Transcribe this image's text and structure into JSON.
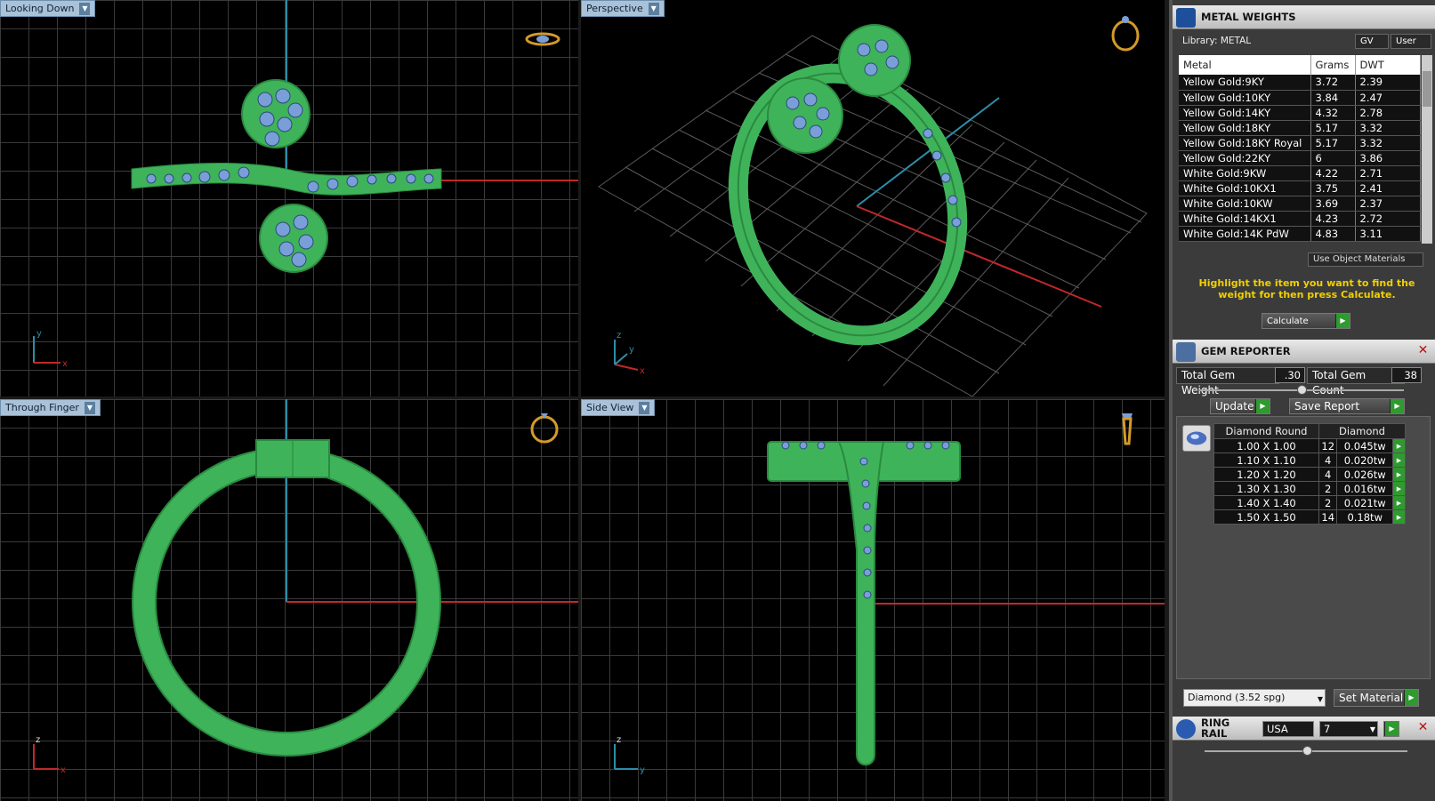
{
  "viewports": {
    "top_left": {
      "label": "Looking Down"
    },
    "top_right": {
      "label": "Perspective"
    },
    "bottom_left": {
      "label": "Through Finger"
    },
    "bottom_right": {
      "label": "Side View"
    }
  },
  "axes": {
    "x": "x",
    "y": "y",
    "z": "z"
  },
  "metal_weights": {
    "title": "METAL WEIGHTS",
    "library": "Library: METAL",
    "gv_label": "GV",
    "user_label": "User",
    "columns": [
      "Metal",
      "Grams",
      "DWT"
    ],
    "rows": [
      {
        "metal": "Yellow Gold:9KY",
        "grams": "3.72",
        "dwt": "2.39"
      },
      {
        "metal": "Yellow Gold:10KY",
        "grams": "3.84",
        "dwt": "2.47"
      },
      {
        "metal": "Yellow Gold:14KY",
        "grams": "4.32",
        "dwt": "2.78"
      },
      {
        "metal": "Yellow Gold:18KY",
        "grams": "5.17",
        "dwt": "3.32"
      },
      {
        "metal": "Yellow Gold:18KY Royal",
        "grams": "5.17",
        "dwt": "3.32"
      },
      {
        "metal": "Yellow Gold:22KY",
        "grams": "6",
        "dwt": "3.86"
      },
      {
        "metal": "White Gold:9KW",
        "grams": "4.22",
        "dwt": "2.71"
      },
      {
        "metal": "White Gold:10KX1",
        "grams": "3.75",
        "dwt": "2.41"
      },
      {
        "metal": "White Gold:10KW",
        "grams": "3.69",
        "dwt": "2.37"
      },
      {
        "metal": "White Gold:14KX1",
        "grams": "4.23",
        "dwt": "2.72"
      },
      {
        "metal": "White Gold:14K PdW",
        "grams": "4.83",
        "dwt": "3.11"
      }
    ],
    "use_object_materials": "Use Object Materials",
    "instruction": "Highlight the item you want to find the weight for then press Calculate.",
    "calculate": "Calculate"
  },
  "gem_reporter": {
    "title": "GEM REPORTER",
    "total_weight_label": "Total Gem Weight",
    "total_weight": ".30",
    "total_count_label": "Total Gem Count",
    "total_count": "38",
    "update": "Update",
    "save_report": "Save Report",
    "columns": [
      "Diamond Round",
      "Diamond"
    ],
    "rows": [
      {
        "size": "1.00 X 1.00",
        "count": "12",
        "tw": "0.045tw"
      },
      {
        "size": "1.10 X 1.10",
        "count": "4",
        "tw": "0.020tw"
      },
      {
        "size": "1.20 X 1.20",
        "count": "4",
        "tw": "0.026tw"
      },
      {
        "size": "1.30 X 1.30",
        "count": "2",
        "tw": "0.016tw"
      },
      {
        "size": "1.40 X 1.40",
        "count": "2",
        "tw": "0.021tw"
      },
      {
        "size": "1.50 X 1.50",
        "count": "14",
        "tw": "0.18tw"
      }
    ],
    "material_select": "Diamond    (3.52 spg)",
    "set_material": "Set Material"
  },
  "ring_rail": {
    "title": "RING RAIL",
    "region": "USA",
    "size": "7"
  },
  "colors": {
    "ring": "#3fb35a",
    "gems": "#7a9fd8",
    "axis_x": "#c0282a",
    "axis_y": "#2c8fa8",
    "icon": "#d49a2a"
  }
}
